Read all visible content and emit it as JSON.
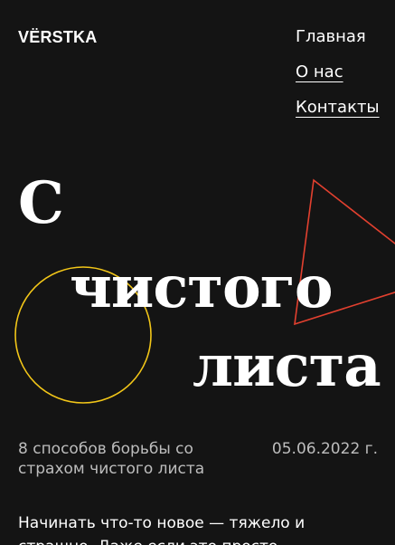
{
  "header": {
    "logo": "VЁRSTKA",
    "nav": [
      {
        "label": "Главная"
      },
      {
        "label": "О нас"
      },
      {
        "label": "Контакты"
      }
    ]
  },
  "hero": {
    "title_lines": [
      "С",
      "чистого",
      "листа"
    ]
  },
  "article": {
    "description": "8 способов борьбы со страхом чистого листа",
    "date": "05.06.2022 г.",
    "intro": "Начинать что-то новое — тяжело и страшно. Даже если это просто"
  },
  "colors": {
    "background": "#141414",
    "text": "#ffffff",
    "muted": "#bdbdbd",
    "circle_stroke": "#f2c618",
    "triangle_stroke": "#e2402f"
  },
  "icons": {
    "circle": "yellow-circle-outline",
    "triangle": "red-triangle-outline"
  }
}
